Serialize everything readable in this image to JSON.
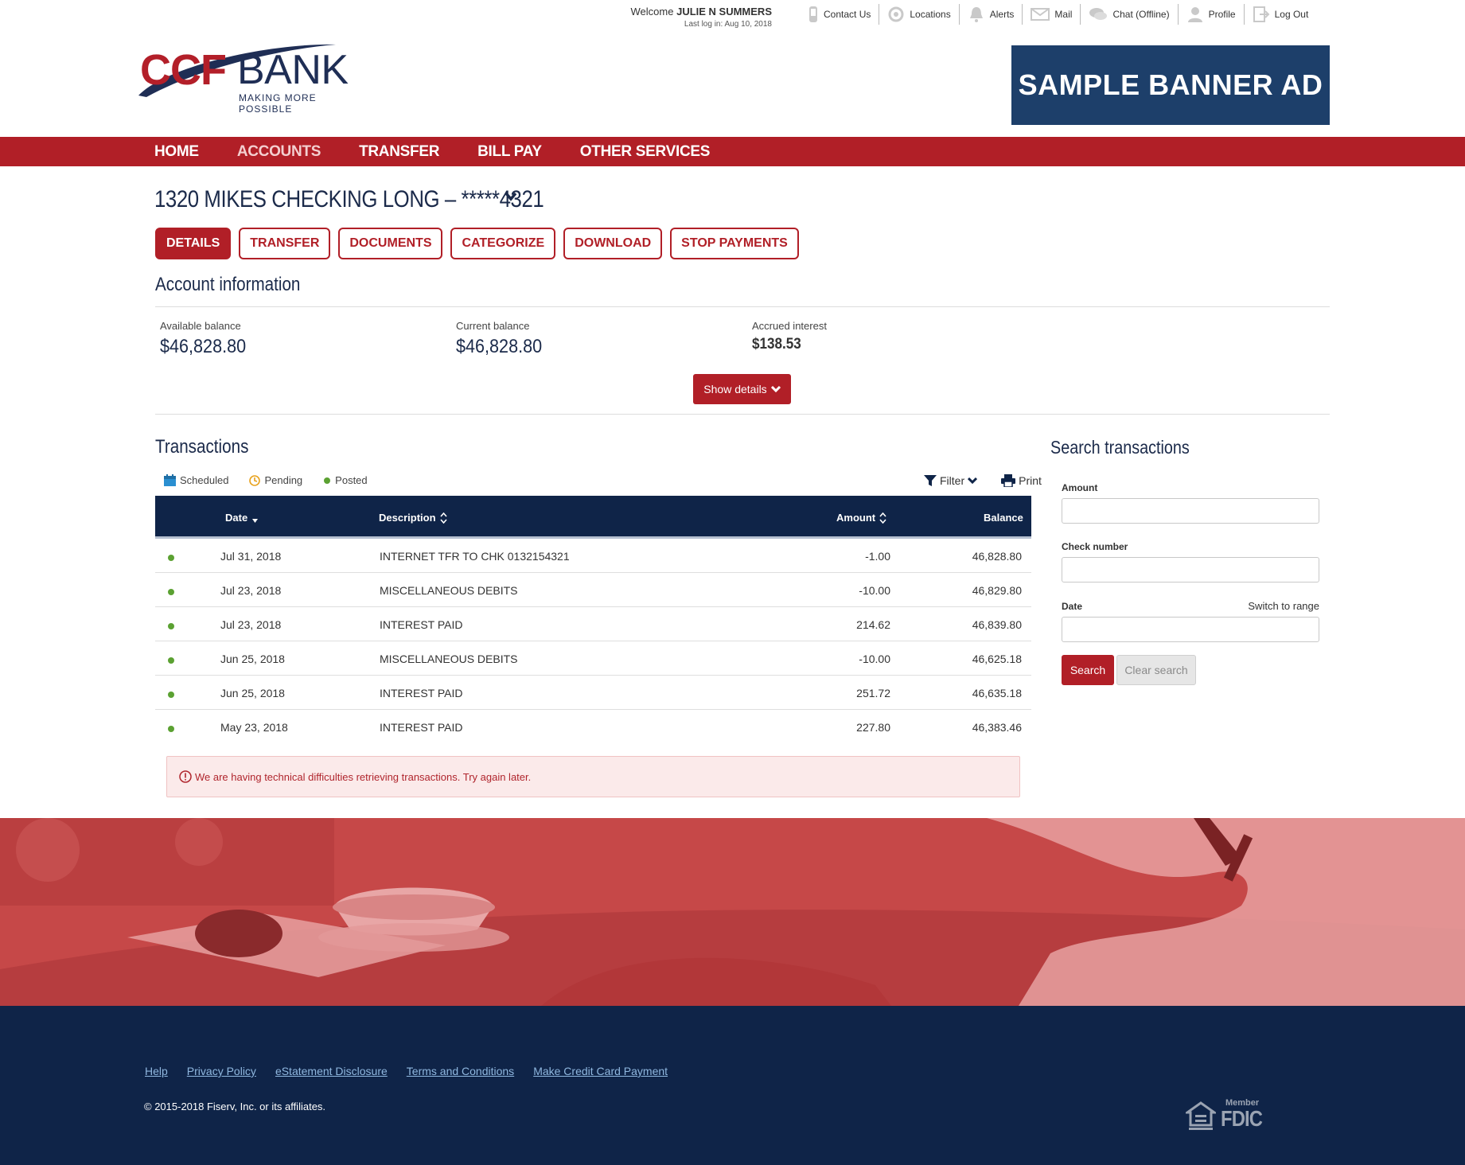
{
  "header": {
    "welcome_prefix": "Welcome",
    "user_name": "JULIE N SUMMERS",
    "last_login": "Last log in: Aug 10, 2018",
    "utilities": [
      {
        "label": "Contact Us",
        "icon": "phone-icon"
      },
      {
        "label": "Locations",
        "icon": "location-icon"
      },
      {
        "label": "Alerts",
        "icon": "bell-icon"
      },
      {
        "label": "Mail",
        "icon": "mail-icon"
      },
      {
        "label": "Chat (Offline)",
        "icon": "chat-icon"
      },
      {
        "label": "Profile",
        "icon": "user-icon"
      },
      {
        "label": "Log Out",
        "icon": "logout-icon"
      }
    ],
    "logo": {
      "ccf": "CCF",
      "bank": "BANK",
      "tagline": "MAKING MORE POSSIBLE"
    },
    "banner_ad": "SAMPLE BANNER AD"
  },
  "nav": {
    "items": [
      "HOME",
      "ACCOUNTS",
      "TRANSFER",
      "BILL PAY",
      "OTHER SERVICES"
    ],
    "active": "ACCOUNTS"
  },
  "account": {
    "title": "1320 MIKES CHECKING LONG – *****4321",
    "tabs": [
      "DETAILS",
      "TRANSFER",
      "DOCUMENTS",
      "CATEGORIZE",
      "DOWNLOAD",
      "STOP PAYMENTS"
    ],
    "active_tab": "DETAILS",
    "info_heading": "Account information",
    "available_label": "Available balance",
    "available_value": "$46,828.80",
    "current_label": "Current balance",
    "current_value": "$46,828.80",
    "interest_label": "Accrued interest",
    "interest_value": "$138.53",
    "show_details": "Show details"
  },
  "transactions": {
    "heading": "Transactions",
    "legend": {
      "scheduled": "Scheduled",
      "pending": "Pending",
      "posted": "Posted"
    },
    "filter": "Filter",
    "print": "Print",
    "columns": {
      "date": "Date",
      "description": "Description",
      "amount": "Amount",
      "balance": "Balance"
    },
    "rows": [
      {
        "date": "Jul 31, 2018",
        "description": "INTERNET TFR TO CHK 0132154321",
        "amount": "-1.00",
        "balance": "46,828.80"
      },
      {
        "date": "Jul 23, 2018",
        "description": "MISCELLANEOUS DEBITS",
        "amount": "-10.00",
        "balance": "46,829.80"
      },
      {
        "date": "Jul 23, 2018",
        "description": "INTEREST PAID",
        "amount": "214.62",
        "balance": "46,839.80"
      },
      {
        "date": "Jun 25, 2018",
        "description": "MISCELLANEOUS DEBITS",
        "amount": "-10.00",
        "balance": "46,625.18"
      },
      {
        "date": "Jun 25, 2018",
        "description": "INTEREST PAID",
        "amount": "251.72",
        "balance": "46,635.18"
      },
      {
        "date": "May 23, 2018",
        "description": "INTEREST PAID",
        "amount": "227.80",
        "balance": "46,383.46"
      }
    ],
    "error": "We are having technical difficulties retrieving transactions. Try again later."
  },
  "search": {
    "heading": "Search transactions",
    "amount_label": "Amount",
    "amount_value": "",
    "check_label": "Check number",
    "check_value": "",
    "date_label": "Date",
    "switch_range": "Switch to range",
    "date_value": "",
    "search_button": "Search",
    "clear_button": "Clear search"
  },
  "footer": {
    "links": [
      "Help",
      "Privacy Policy",
      "eStatement Disclosure",
      "Terms and Conditions",
      "Make Credit Card Payment"
    ],
    "copyright": "© 2015-2018 Fiserv, Inc. or its affiliates.",
    "fdic_member": "Member",
    "fdic": "FDIC"
  },
  "colors": {
    "brand_red": "#b11f27",
    "navy": "#0f2448",
    "banner_blue": "#1d3f6a",
    "posted_green": "#5ba132"
  }
}
